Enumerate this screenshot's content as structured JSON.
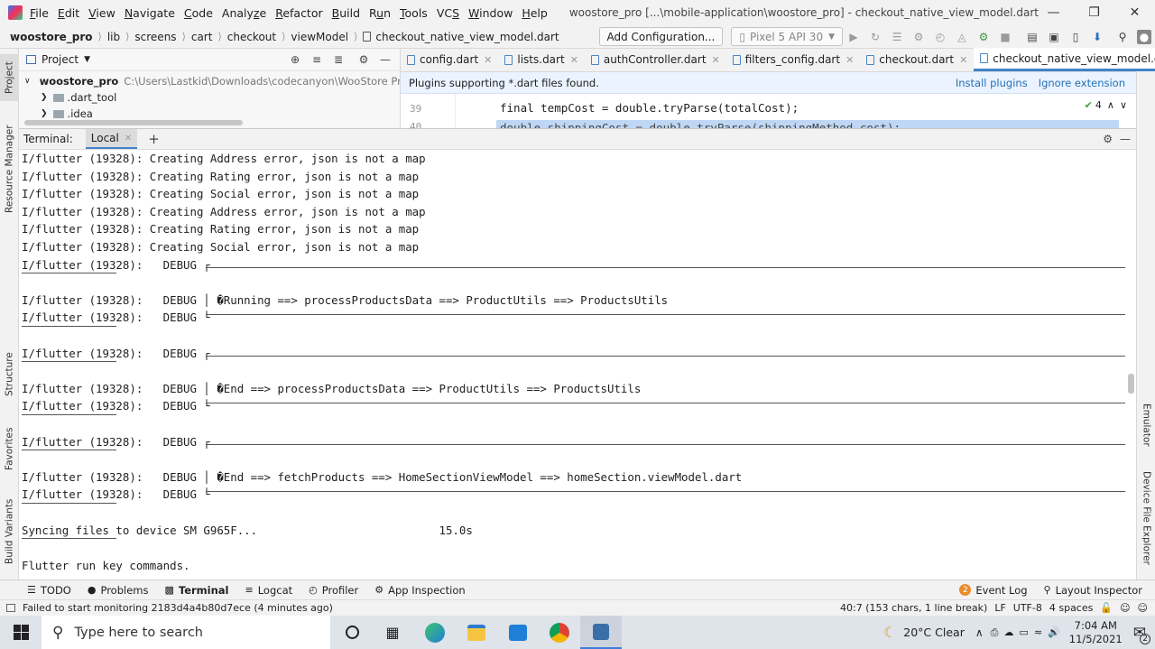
{
  "menubar": {
    "items": [
      "File",
      "Edit",
      "View",
      "Navigate",
      "Code",
      "Analyze",
      "Refactor",
      "Build",
      "Run",
      "Tools",
      "VCS",
      "Window",
      "Help"
    ],
    "mnemonics": [
      "F",
      "E",
      "V",
      "N",
      "C",
      "z",
      "R",
      "B",
      "u",
      "T",
      "S",
      "W",
      "H"
    ],
    "window_title": "woostore_pro [...\\mobile-application\\woostore_pro] - checkout_native_view_model.dart"
  },
  "breadcrumb": [
    "woostore_pro",
    "lib",
    "screens",
    "cart",
    "checkout",
    "viewModel",
    "checkout_native_view_model.dart"
  ],
  "toolbar": {
    "add_config": "Add Configuration...",
    "device": "Pixel 5 API 30"
  },
  "project": {
    "title": "Project",
    "root_name": "woostore_pro",
    "root_path": "C:\\Users\\Lastkid\\Downloads\\codecanyon\\WooStore Pro - Fu",
    "items": [
      ".dart_tool",
      ".idea"
    ]
  },
  "editor": {
    "tabs": [
      "config.dart",
      "lists.dart",
      "authController.dart",
      "filters_config.dart",
      "checkout.dart",
      "checkout_native_view_model.dart"
    ],
    "banner_text": "Plugins supporting *.dart files found.",
    "install_plugins": "Install plugins",
    "ignore_extension": "Ignore extension",
    "line_numbers": [
      "39",
      "40"
    ],
    "code_lines": [
      "final tempCost = double.tryParse(totalCost);",
      "double shippingCost = double.tryParse(shippingMethod.cost);"
    ],
    "problems_count": "4"
  },
  "terminal": {
    "label": "Terminal:",
    "tab": "Local",
    "lines": [
      "I/flutter (19328): Creating Address error, json is not a map",
      "I/flutter (19328): Creating Rating error, json is not a map",
      "I/flutter (19328): Creating Social error, json is not a map",
      "I/flutter (19328): Creating Address error, json is not a map",
      "I/flutter (19328): Creating Rating error, json is not a map",
      "I/flutter (19328): Creating Social error, json is not a map",
      "I/flutter (19328):   DEBUG ┌",
      "",
      "I/flutter (19328):   DEBUG │ �Running ==> processProductsData ==> ProductUtils ==> ProductsUtils",
      "I/flutter (19328):   DEBUG └",
      "",
      "I/flutter (19328):   DEBUG ┌",
      "",
      "I/flutter (19328):   DEBUG │ �End ==> processProductsData ==> ProductUtils ==> ProductsUtils",
      "I/flutter (19328):   DEBUG └",
      "",
      "I/flutter (19328):   DEBUG ┌",
      "",
      "I/flutter (19328):   DEBUG │ �End ==> fetchProducts ==> HomeSectionViewModel ==> homeSection.viewModel.dart",
      "I/flutter (19328):   DEBUG └",
      "",
      "Syncing files to device SM G965F...                           15.0s",
      "",
      "Flutter run key commands."
    ]
  },
  "left_tabs": [
    "Project",
    "Resource Manager",
    "Structure",
    "Favorites",
    "Build Variants"
  ],
  "right_tabs": [
    "Emulator",
    "Device File Explorer"
  ],
  "bottom_tabs": [
    "TODO",
    "Problems",
    "Terminal",
    "Logcat",
    "Profiler",
    "App Inspection"
  ],
  "bottom_right": {
    "event_log": "Event Log",
    "event_count": "2",
    "layout_inspector": "Layout Inspector"
  },
  "status": {
    "message": "Failed to start monitoring 2183d4a4b80d7ece (4 minutes ago)",
    "position": "40:7 (153 chars, 1 line break)",
    "line_sep": "LF",
    "encoding": "UTF-8",
    "indent": "4 spaces"
  },
  "taskbar": {
    "search_placeholder": "Type here to search",
    "weather": "20°C  Clear",
    "time": "7:04 AM",
    "date": "11/5/2021",
    "notif_count": "2"
  },
  "colors": {
    "accent": "#4083c9",
    "link": "#2470b3",
    "banner": "#eaf3ff"
  }
}
